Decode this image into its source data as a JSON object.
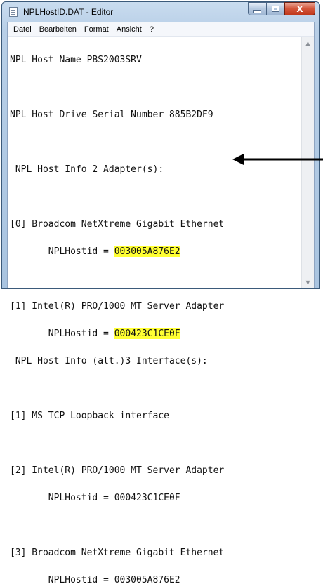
{
  "window": {
    "title": "NPLHostID.DAT - Editor",
    "buttons": {
      "minimize": "minimize",
      "maximize": "maximize",
      "close": "X"
    }
  },
  "menu": [
    "Datei",
    "Bearbeiten",
    "Format",
    "Ansicht",
    "?"
  ],
  "content": {
    "lines": [
      "NPL Host Name PBS2003SRV",
      "",
      "NPL Host Drive Serial Number 885B2DF9",
      "",
      " NPL Host Info 2 Adapter(s):",
      "",
      "[0] Broadcom NetXtreme Gigabit Ethernet",
      "       NPLHostid = ",
      "",
      "[1] Intel(R) PRO/1000 MT Server Adapter",
      "       NPLHostid = ",
      " NPL Host Info (alt.)3 Interface(s):",
      "",
      "[1] MS TCP Loopback interface",
      "",
      "[2] Intel(R) PRO/1000 MT Server Adapter",
      "       NPLHostid = 000423C1CE0F",
      "",
      "[3] Broadcom NetXtreme Gigabit Ethernet",
      "       NPLHostid = 003005A876E2"
    ],
    "highlighted": {
      "adapter0_hostid": "003005A876E2",
      "adapter1_hostid": "000423C1CE0F"
    }
  },
  "scrollbar": {
    "up": "▲",
    "down": "▼"
  },
  "colors": {
    "highlight": "#ffff33",
    "arrow": "#000000"
  },
  "annotation": {
    "icon": "arrow-left-icon"
  }
}
